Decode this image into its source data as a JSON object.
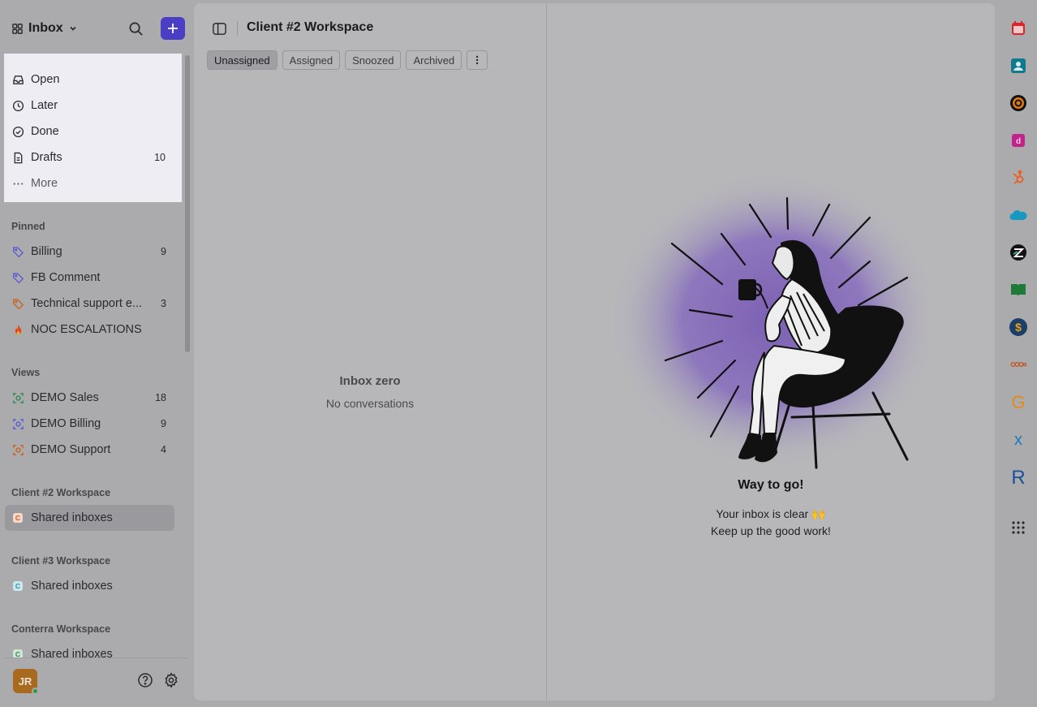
{
  "sidebar": {
    "inbox_title": "Inbox",
    "menu": [
      {
        "label": "Open",
        "count": ""
      },
      {
        "label": "Later",
        "count": ""
      },
      {
        "label": "Done",
        "count": ""
      },
      {
        "label": "Drafts",
        "count": "10"
      },
      {
        "label": "More",
        "count": ""
      }
    ],
    "pinned": {
      "heading": "Pinned",
      "items": [
        {
          "label": "Billing",
          "count": "9",
          "icon": "tag-icon",
          "color": "#5b57d6"
        },
        {
          "label": "FB Comment",
          "count": "",
          "icon": "tag-icon",
          "color": "#5b57d6"
        },
        {
          "label": "Technical support e...",
          "count": "3",
          "icon": "tag-icon",
          "color": "#c8621d"
        },
        {
          "label": "NOC ESCALATIONS",
          "count": "",
          "icon": "fire-icon",
          "color": "#e0481b"
        }
      ]
    },
    "views": {
      "heading": "Views",
      "items": [
        {
          "label": "DEMO Sales",
          "count": "18",
          "color": "#2e8a4f"
        },
        {
          "label": "DEMO Billing",
          "count": "9",
          "color": "#5b57d6"
        },
        {
          "label": "DEMO Support",
          "count": "4",
          "color": "#c8621d"
        }
      ]
    },
    "workspaces": [
      {
        "heading": "Client #2 Workspace",
        "item": "Shared inboxes",
        "badge": "C",
        "color": "#d35a1f"
      },
      {
        "heading": "Client #3 Workspace",
        "item": "Shared inboxes",
        "badge": "C",
        "color": "#2b8fa6"
      },
      {
        "heading": "Conterra Workspace",
        "item": "Shared inboxes",
        "badge": "C",
        "color": "#2e8a4f"
      }
    ],
    "user_initials": "JR"
  },
  "main": {
    "workspace_title": "Client #2 Workspace",
    "tabs": [
      "Unassigned",
      "Assigned",
      "Snoozed",
      "Archived"
    ],
    "empty_title": "Inbox zero",
    "empty_subtitle": "No conversations",
    "done_title": "Way to go!",
    "done_line1": "Your inbox is clear 🙌",
    "done_line2": "Keep up the good work!"
  },
  "colors": {
    "accent": "#4a3ec4",
    "online": "#2d9b4a"
  },
  "rail_apps": [
    "calendar-icon",
    "contacts-icon",
    "target-app-icon",
    "deputy-app-icon",
    "hubspot-icon",
    "salesforce-icon",
    "zendesk-icon",
    "book-app-icon",
    "dollar-app-icon",
    "dots-app-icon",
    "g-app-icon",
    "x-app-icon",
    "r-app-icon",
    "apps-grid-icon"
  ]
}
